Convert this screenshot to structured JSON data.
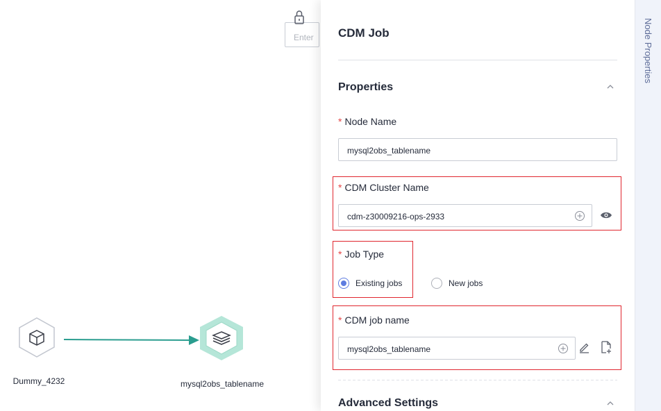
{
  "canvas": {
    "search_placeholder": "Enter",
    "nodes": [
      {
        "label": "Dummy_4232"
      },
      {
        "label": "mysql2obs_tablename"
      }
    ]
  },
  "panel": {
    "title": "CDM Job",
    "properties_section": "Properties",
    "node_name": {
      "label": "Node Name",
      "value": "mysql2obs_tablename"
    },
    "cdm_cluster_name": {
      "label": "CDM Cluster Name",
      "value": "cdm-z30009216-ops-2933"
    },
    "job_type": {
      "label": "Job Type",
      "options": [
        "Existing jobs",
        "New jobs"
      ],
      "selected": "Existing jobs"
    },
    "cdm_job_name": {
      "label": "CDM job name",
      "value": "mysql2obs_tablename"
    },
    "advanced_section": "Advanced Settings",
    "required_mark": "*"
  },
  "side_tab": {
    "label": "Node Properties"
  },
  "colors": {
    "accent": "#5e7ce0",
    "highlight": "#e0262e",
    "required": "#e54545",
    "edge": "#2a9d8f",
    "node_active": "#b5e6d8"
  },
  "icons": [
    "lock-icon",
    "chevron-up-icon",
    "plus-circle-icon",
    "eye-icon",
    "edit-icon",
    "new-file-icon",
    "cube-icon",
    "layers-icon"
  ]
}
